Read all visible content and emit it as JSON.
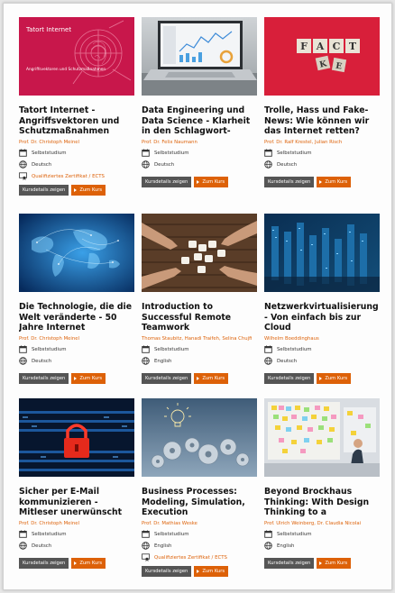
{
  "colors": {
    "accent": "#dd6108",
    "details_button": "#555555"
  },
  "labels": {
    "details": "Kursdetails zeigen",
    "go": "Zum Kurs"
  },
  "courses": [
    {
      "title": "Tatort Internet - Angriffsvektoren und Schutzmaßnahmen",
      "authors": "Prof. Dr. Christoph Meinel",
      "format": "Selbststudium",
      "language": "Deutsch",
      "certificate": "Qualifiziertes Zertifikat / ECTS",
      "thumb_title": "Tatort Internet",
      "thumb_subtitle": "Angriffsvektoren und Schutzmaßnahmen"
    },
    {
      "title": "Data Engineering und Data Science - Klarheit in den Schlagwort-Dschungel",
      "authors": "Prof. Dr. Felix Naumann",
      "format": "Selbststudium",
      "language": "Deutsch"
    },
    {
      "title": "Trolle, Hass und Fake-News: Wie können wir das Internet retten?",
      "authors": "Prof. Dr. Ralf Krestel, Julian Risch",
      "format": "Selbststudium",
      "language": "Deutsch",
      "thumb_letters": [
        "F",
        "A",
        "C",
        "T",
        "K",
        "E"
      ]
    },
    {
      "title": "Die Technologie, die die Welt veränderte - 50 Jahre Internet",
      "authors": "Prof. Dr. Christoph Meinel",
      "format": "Selbststudium",
      "language": "Deutsch"
    },
    {
      "title": "Introduction to Successful Remote Teamwork",
      "authors": "Thomas Staubitz, Hanadi Traifeh, Selina Chujfi",
      "format": "Selbststudium",
      "language": "English"
    },
    {
      "title": "Netzwerkvirtualisierung - Von einfach bis zur Cloud",
      "authors": "Wilhelm Boeddinghaus",
      "format": "Selbststudium",
      "language": "Deutsch"
    },
    {
      "title": "Sicher per E-Mail kommunizieren - Mitleser unerwünscht",
      "authors": "Prof. Dr. Christoph Meinel",
      "format": "Selbststudium",
      "language": "Deutsch"
    },
    {
      "title": "Business Processes: Modeling, Simulation, Execution",
      "authors": "Prof. Dr. Mathias Weske",
      "format": "Selbststudium",
      "language": "English",
      "certificate": "Qualifiziertes Zertifikat / ECTS"
    },
    {
      "title": "Beyond Brockhaus Thinking: With Design Thinking to a Networked...",
      "authors": "Prof. Ulrich Weinberg, Dr. Claudia Nicolai",
      "format": "Selbststudium",
      "language": "English"
    }
  ]
}
